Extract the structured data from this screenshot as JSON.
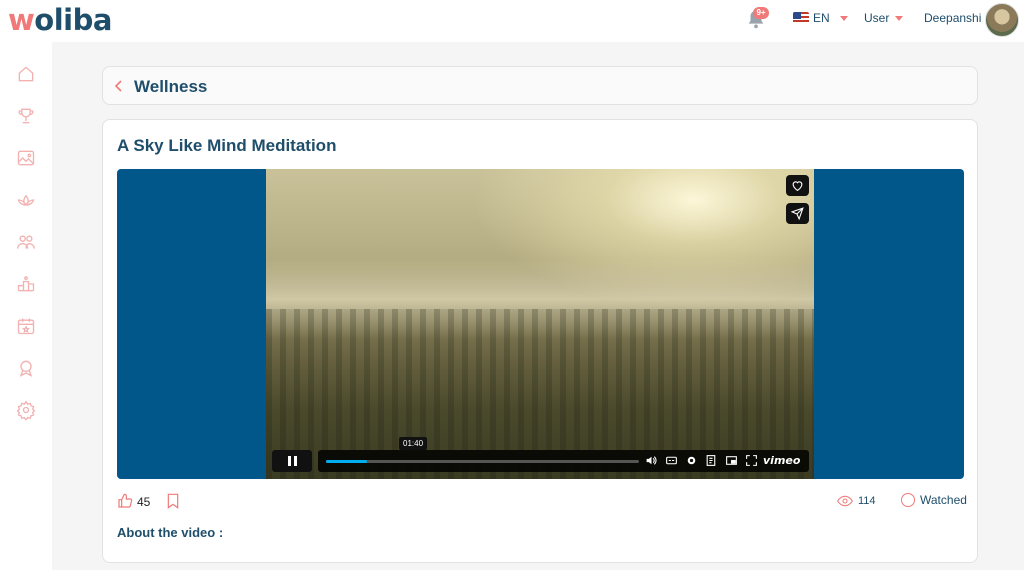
{
  "header": {
    "logo": "woliba",
    "notifications_badge": "9+",
    "language": "EN",
    "user_menu_label": "User",
    "username": "Deepanshi"
  },
  "breadcrumb": {
    "title": "Wellness"
  },
  "video": {
    "title": "A Sky Like Mind Meditation",
    "timecode": "01:40",
    "progress_fraction": 0.13,
    "player_brand": "vimeo"
  },
  "stats": {
    "likes": "45",
    "views": "114",
    "watched_label": "Watched"
  },
  "about_label": "About the video :",
  "colors": {
    "accent": "#f07a7a",
    "brand": "#1f4e6b",
    "player_bg": "#02578a",
    "progress": "#00adef"
  },
  "icons": {
    "sidebar": [
      "home-icon",
      "trophy-icon",
      "image-icon",
      "lotus-icon",
      "people-icon",
      "podium-icon",
      "calendar-icon",
      "badge-icon",
      "gear-icon"
    ]
  }
}
